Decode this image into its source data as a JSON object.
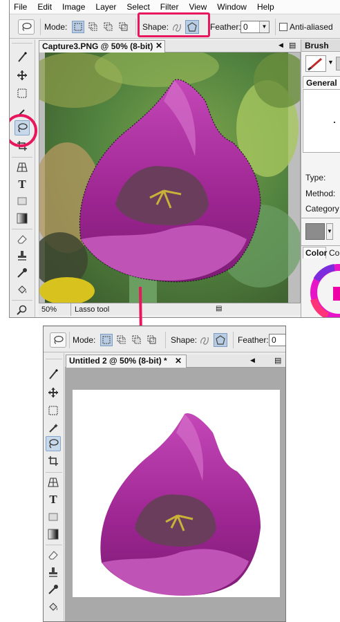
{
  "top": {
    "menu": [
      "File",
      "Edit",
      "Image",
      "Layer",
      "Select",
      "Filter",
      "View",
      "Window",
      "Help"
    ],
    "options": {
      "mode_label": "Mode:",
      "shape_label": "Shape:",
      "feather_label": "Feather:",
      "feather_value": "0",
      "antialias_label": "Anti-aliased"
    },
    "document": {
      "tab_title": "Capture3.PNG @ 50% (8-bit)",
      "close_glyph": "✕",
      "zoom": "50%",
      "status_text": "Lasso tool"
    },
    "panel": {
      "brush_tab": "Brush",
      "general_tab": "General",
      "type_label": "Type:",
      "method_label": "Method:",
      "category_label": "Category",
      "color_tab": "Color",
      "color_tab_2": "Co"
    }
  },
  "bottom": {
    "options": {
      "mode_label": "Mode:",
      "shape_label": "Shape:",
      "feather_label": "Feather:",
      "feather_value": "0"
    },
    "document": {
      "tab_title": "Untitled 2 @ 50% (8-bit) *",
      "close_glyph": "✕"
    }
  },
  "colors": {
    "highlight": "#e8175d",
    "tulip": "#a0279a",
    "selected_button": "#b8cde3"
  }
}
